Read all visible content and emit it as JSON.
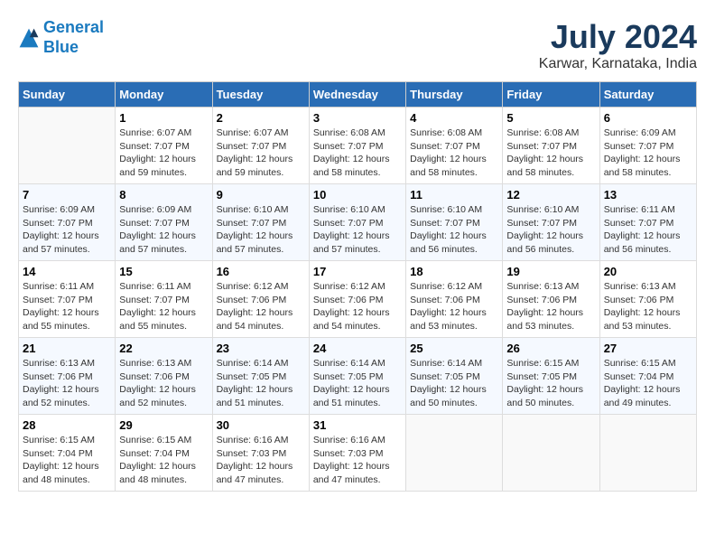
{
  "header": {
    "logo_line1": "General",
    "logo_line2": "Blue",
    "month_year": "July 2024",
    "location": "Karwar, Karnataka, India"
  },
  "weekdays": [
    "Sunday",
    "Monday",
    "Tuesday",
    "Wednesday",
    "Thursday",
    "Friday",
    "Saturday"
  ],
  "weeks": [
    [
      {
        "day": "",
        "info": ""
      },
      {
        "day": "1",
        "info": "Sunrise: 6:07 AM\nSunset: 7:07 PM\nDaylight: 12 hours\nand 59 minutes."
      },
      {
        "day": "2",
        "info": "Sunrise: 6:07 AM\nSunset: 7:07 PM\nDaylight: 12 hours\nand 59 minutes."
      },
      {
        "day": "3",
        "info": "Sunrise: 6:08 AM\nSunset: 7:07 PM\nDaylight: 12 hours\nand 58 minutes."
      },
      {
        "day": "4",
        "info": "Sunrise: 6:08 AM\nSunset: 7:07 PM\nDaylight: 12 hours\nand 58 minutes."
      },
      {
        "day": "5",
        "info": "Sunrise: 6:08 AM\nSunset: 7:07 PM\nDaylight: 12 hours\nand 58 minutes."
      },
      {
        "day": "6",
        "info": "Sunrise: 6:09 AM\nSunset: 7:07 PM\nDaylight: 12 hours\nand 58 minutes."
      }
    ],
    [
      {
        "day": "7",
        "info": "Sunrise: 6:09 AM\nSunset: 7:07 PM\nDaylight: 12 hours\nand 57 minutes."
      },
      {
        "day": "8",
        "info": "Sunrise: 6:09 AM\nSunset: 7:07 PM\nDaylight: 12 hours\nand 57 minutes."
      },
      {
        "day": "9",
        "info": "Sunrise: 6:10 AM\nSunset: 7:07 PM\nDaylight: 12 hours\nand 57 minutes."
      },
      {
        "day": "10",
        "info": "Sunrise: 6:10 AM\nSunset: 7:07 PM\nDaylight: 12 hours\nand 57 minutes."
      },
      {
        "day": "11",
        "info": "Sunrise: 6:10 AM\nSunset: 7:07 PM\nDaylight: 12 hours\nand 56 minutes."
      },
      {
        "day": "12",
        "info": "Sunrise: 6:10 AM\nSunset: 7:07 PM\nDaylight: 12 hours\nand 56 minutes."
      },
      {
        "day": "13",
        "info": "Sunrise: 6:11 AM\nSunset: 7:07 PM\nDaylight: 12 hours\nand 56 minutes."
      }
    ],
    [
      {
        "day": "14",
        "info": "Sunrise: 6:11 AM\nSunset: 7:07 PM\nDaylight: 12 hours\nand 55 minutes."
      },
      {
        "day": "15",
        "info": "Sunrise: 6:11 AM\nSunset: 7:07 PM\nDaylight: 12 hours\nand 55 minutes."
      },
      {
        "day": "16",
        "info": "Sunrise: 6:12 AM\nSunset: 7:06 PM\nDaylight: 12 hours\nand 54 minutes."
      },
      {
        "day": "17",
        "info": "Sunrise: 6:12 AM\nSunset: 7:06 PM\nDaylight: 12 hours\nand 54 minutes."
      },
      {
        "day": "18",
        "info": "Sunrise: 6:12 AM\nSunset: 7:06 PM\nDaylight: 12 hours\nand 53 minutes."
      },
      {
        "day": "19",
        "info": "Sunrise: 6:13 AM\nSunset: 7:06 PM\nDaylight: 12 hours\nand 53 minutes."
      },
      {
        "day": "20",
        "info": "Sunrise: 6:13 AM\nSunset: 7:06 PM\nDaylight: 12 hours\nand 53 minutes."
      }
    ],
    [
      {
        "day": "21",
        "info": "Sunrise: 6:13 AM\nSunset: 7:06 PM\nDaylight: 12 hours\nand 52 minutes."
      },
      {
        "day": "22",
        "info": "Sunrise: 6:13 AM\nSunset: 7:06 PM\nDaylight: 12 hours\nand 52 minutes."
      },
      {
        "day": "23",
        "info": "Sunrise: 6:14 AM\nSunset: 7:05 PM\nDaylight: 12 hours\nand 51 minutes."
      },
      {
        "day": "24",
        "info": "Sunrise: 6:14 AM\nSunset: 7:05 PM\nDaylight: 12 hours\nand 51 minutes."
      },
      {
        "day": "25",
        "info": "Sunrise: 6:14 AM\nSunset: 7:05 PM\nDaylight: 12 hours\nand 50 minutes."
      },
      {
        "day": "26",
        "info": "Sunrise: 6:15 AM\nSunset: 7:05 PM\nDaylight: 12 hours\nand 50 minutes."
      },
      {
        "day": "27",
        "info": "Sunrise: 6:15 AM\nSunset: 7:04 PM\nDaylight: 12 hours\nand 49 minutes."
      }
    ],
    [
      {
        "day": "28",
        "info": "Sunrise: 6:15 AM\nSunset: 7:04 PM\nDaylight: 12 hours\nand 48 minutes."
      },
      {
        "day": "29",
        "info": "Sunrise: 6:15 AM\nSunset: 7:04 PM\nDaylight: 12 hours\nand 48 minutes."
      },
      {
        "day": "30",
        "info": "Sunrise: 6:16 AM\nSunset: 7:03 PM\nDaylight: 12 hours\nand 47 minutes."
      },
      {
        "day": "31",
        "info": "Sunrise: 6:16 AM\nSunset: 7:03 PM\nDaylight: 12 hours\nand 47 minutes."
      },
      {
        "day": "",
        "info": ""
      },
      {
        "day": "",
        "info": ""
      },
      {
        "day": "",
        "info": ""
      }
    ]
  ]
}
